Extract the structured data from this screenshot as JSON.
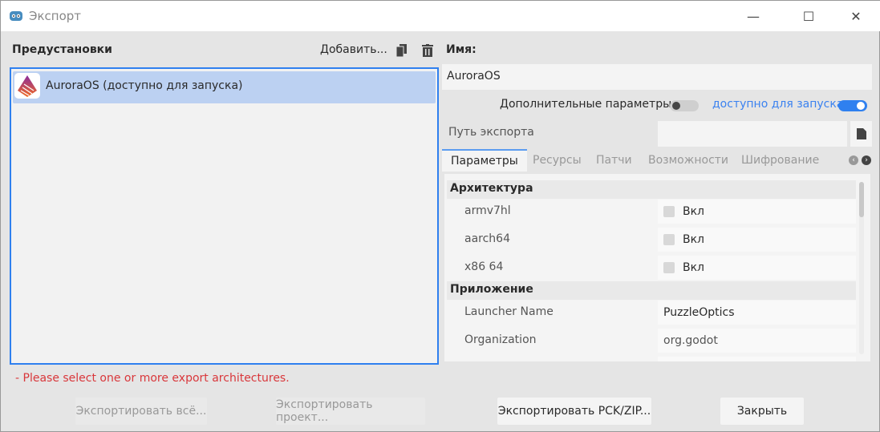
{
  "window": {
    "title": "Экспорт",
    "minimize": "—",
    "maximize": "☐",
    "close": "✕"
  },
  "presets": {
    "header": "Предустановки",
    "add_label": "Добавить...",
    "items": [
      {
        "label": "AuroraOS (доступно для запуска)",
        "selected": true
      }
    ]
  },
  "details": {
    "name_label": "Имя:",
    "name_value": "AuroraOS",
    "advanced_label": "Дополнительные параметры",
    "advanced_on": false,
    "runnable_label": "доступно для запуска",
    "runnable_on": true,
    "export_path_label": "Путь экспорта",
    "export_path_value": "",
    "tabs": [
      {
        "label": "Параметры",
        "active": true
      },
      {
        "label": "Ресурсы"
      },
      {
        "label": "Патчи"
      },
      {
        "label": "Возможности"
      },
      {
        "label": "Шифрование"
      }
    ],
    "sections": [
      {
        "title": "Архитектура",
        "props": [
          {
            "label": "armv7hl",
            "value": "Вкл",
            "checked": false
          },
          {
            "label": "aarch64",
            "value": "Вкл",
            "checked": false
          },
          {
            "label": "x86 64",
            "value": "Вкл",
            "checked": false
          }
        ]
      },
      {
        "title": "Приложение",
        "props": [
          {
            "label": "Launcher Name",
            "value": "PuzzleOptics"
          },
          {
            "label": "Organization",
            "value": "org.godot"
          }
        ]
      }
    ]
  },
  "error": "- Please select one or more export architectures.",
  "buttons": {
    "export_all": "Экспортировать всё...",
    "export_project": "Экспортировать проект...",
    "export_pck": "Экспортировать PCK/ZIP...",
    "close": "Закрыть"
  },
  "colors": {
    "accent": "#2f80ef",
    "error": "#d9373b",
    "selection": "#bcd1f2"
  }
}
